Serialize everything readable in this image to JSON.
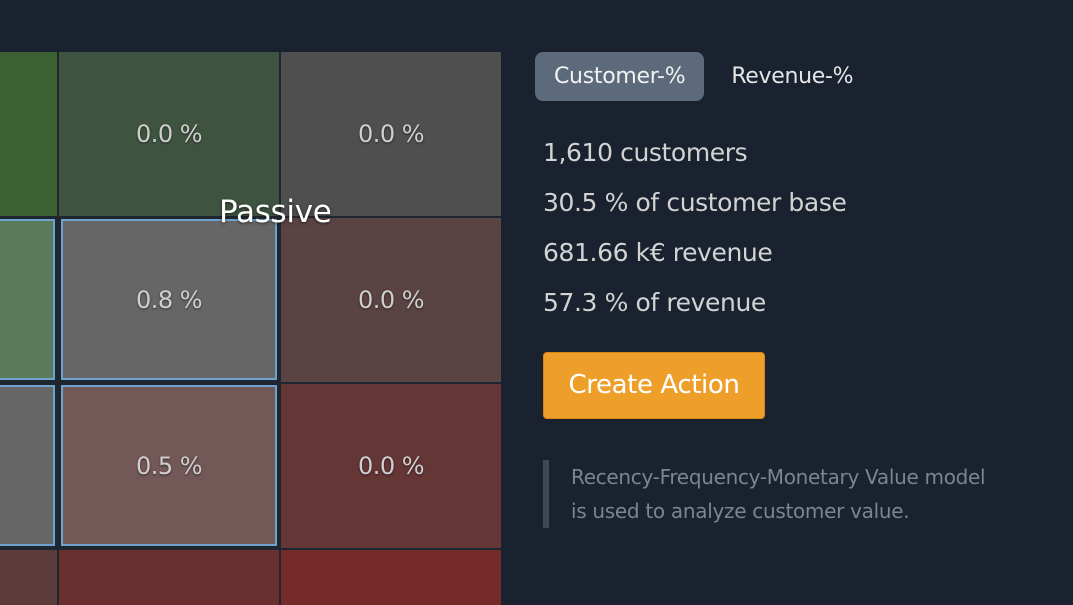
{
  "matrix": {
    "segment_label": "Passive",
    "cells": [
      {
        "value": "",
        "color": "#3c6233"
      },
      {
        "value": "0.0 %",
        "color": "#3f5440"
      },
      {
        "value": "0.0 %",
        "color": "#4f4f4f"
      },
      {
        "value": "",
        "color": "#5b7a59",
        "selected": true
      },
      {
        "value": "0.8 %",
        "color": "#666666",
        "selected": true
      },
      {
        "value": "0.0 %",
        "color": "#5a4343"
      },
      {
        "value": "",
        "color": "#666666",
        "selected": true
      },
      {
        "value": "0.5 %",
        "color": "#735858",
        "selected": true
      },
      {
        "value": "0.0 %",
        "color": "#643636"
      },
      {
        "value": "",
        "color": "#5b3b3b"
      },
      {
        "value": "",
        "color": "#6a2f2f"
      },
      {
        "value": "",
        "color": "#742b2a"
      }
    ]
  },
  "tabs": [
    {
      "label": "Customer-%",
      "active": true
    },
    {
      "label": "Revenue-%",
      "active": false
    }
  ],
  "stats": {
    "customers": "1,610 customers",
    "customer_share": "30.5 % of customer base",
    "revenue": "681.66 k€ revenue",
    "revenue_share": "57.3 % of revenue"
  },
  "action_button": "Create Action",
  "note": {
    "line1": "Recency-Frequency-Monetary Value model",
    "line2": "is used to analyze customer value."
  },
  "colors": {
    "background": "#19222e",
    "accent": "#ee9f2a",
    "selection": "#6ea2cf",
    "tab_active": "#5c6a7c"
  }
}
